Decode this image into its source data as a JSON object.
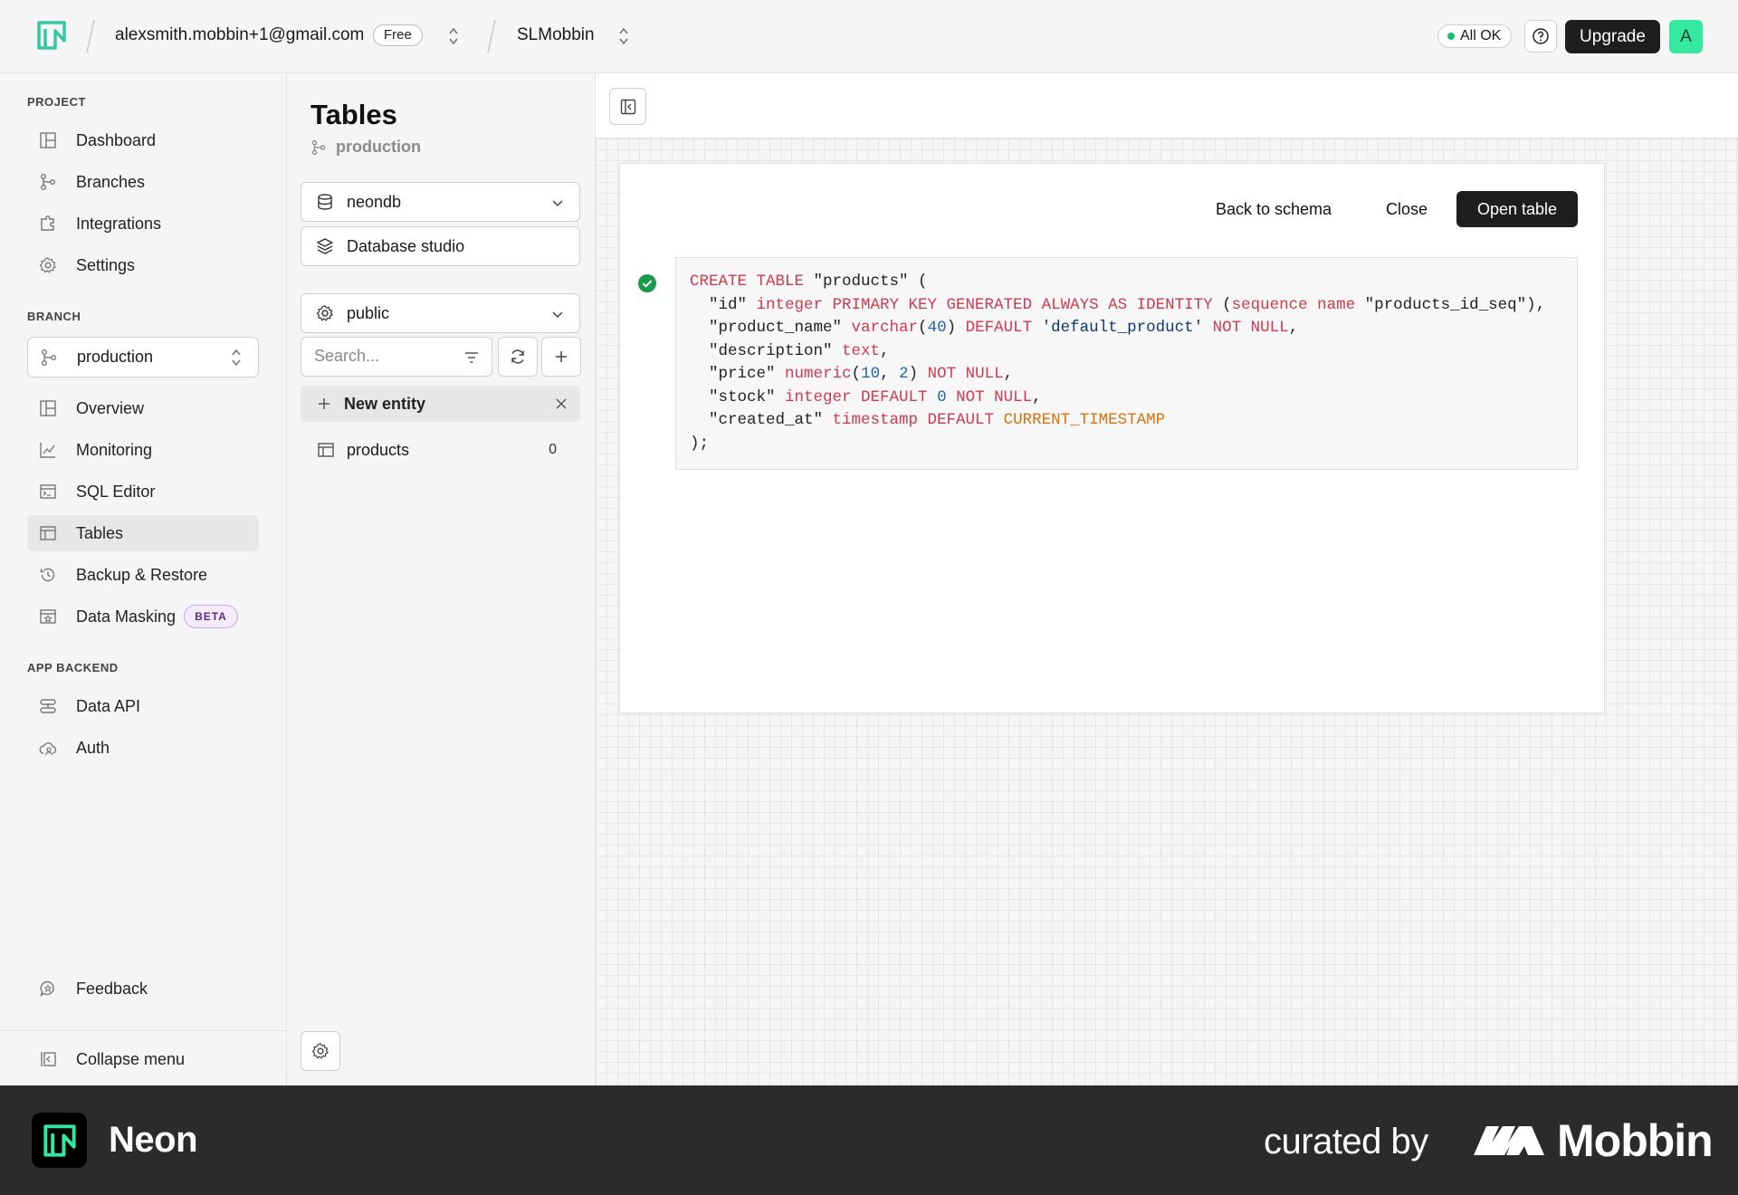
{
  "topbar": {
    "account_email": "alexsmith.mobbin+1@gmail.com",
    "plan_badge": "Free",
    "project_name": "SLMobbin",
    "status": "All OK",
    "upgrade_label": "Upgrade",
    "avatar_initial": "A"
  },
  "sidebar": {
    "project_label": "PROJECT",
    "project_items": [
      {
        "label": "Dashboard",
        "icon": "grid-icon"
      },
      {
        "label": "Branches",
        "icon": "branch-icon"
      },
      {
        "label": "Integrations",
        "icon": "puzzle-icon"
      },
      {
        "label": "Settings",
        "icon": "gear-icon"
      }
    ],
    "branch_label": "BRANCH",
    "branch_select": "production",
    "branch_items": [
      {
        "label": "Overview",
        "icon": "grid-icon"
      },
      {
        "label": "Monitoring",
        "icon": "chart-icon"
      },
      {
        "label": "SQL Editor",
        "icon": "terminal-icon"
      },
      {
        "label": "Tables",
        "icon": "table-icon",
        "active": true
      },
      {
        "label": "Backup & Restore",
        "icon": "history-icon"
      },
      {
        "label": "Data Masking",
        "icon": "mask-icon",
        "badge": "BETA"
      }
    ],
    "backend_label": "APP BACKEND",
    "backend_items": [
      {
        "label": "Data API",
        "icon": "api-icon"
      },
      {
        "label": "Auth",
        "icon": "cloud-user-icon"
      }
    ],
    "feedback_label": "Feedback",
    "collapse_label": "Collapse menu"
  },
  "tables_panel": {
    "title": "Tables",
    "branch": "production",
    "database": "neondb",
    "studio_label": "Database studio",
    "schema": "public",
    "search_placeholder": "Search...",
    "new_entity_label": "New entity",
    "tables": [
      {
        "name": "products",
        "count": "0"
      }
    ]
  },
  "card": {
    "back_label": "Back to schema",
    "close_label": "Close",
    "open_label": "Open table"
  },
  "footer": {
    "brand": "Neon",
    "curated_by": "curated by",
    "mobbin": "Mobbin"
  },
  "colors": {
    "accent_green": "#34e8a0",
    "status_dot": "#1bbf6a",
    "keyword": "#d03a50",
    "number": "#1f62b8",
    "function": "#d6720a"
  }
}
